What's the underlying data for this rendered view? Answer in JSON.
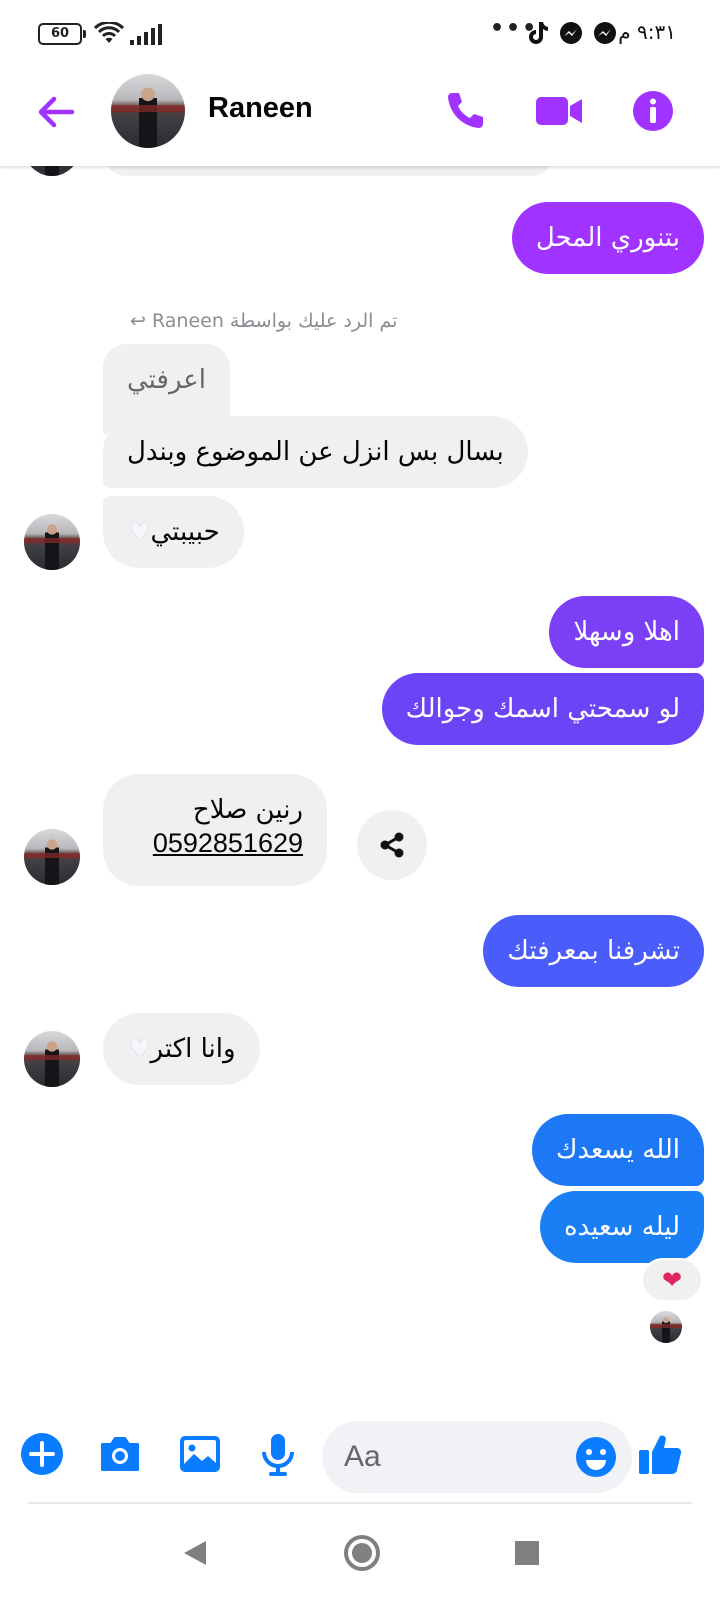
{
  "status_bar": {
    "battery": "60",
    "time": "٩:٣١ م",
    "dots": "•••",
    "icons": [
      "battery-icon",
      "wifi-icon",
      "signal-icon",
      "tiktok-icon",
      "messenger-icon",
      "messenger-icon"
    ]
  },
  "header": {
    "name": "Raneen",
    "accent": "#a033ff",
    "icons": [
      "back-arrow-icon",
      "phone-icon",
      "video-icon",
      "info-icon"
    ]
  },
  "messages": {
    "m1": "بتنوري المحل",
    "reply_label": "تم الرد عليك بواسطة Raneen ↩",
    "quoted": "اعرفتي",
    "m2": "بسال بس انزل عن الموضوع وبندل",
    "m3": "حبيبتي",
    "m4": "اهلا وسهلا",
    "m5": "لو سمحتي اسمك وجوالك",
    "contact_name": "رنين صلاح",
    "contact_phone": "0592851629",
    "m6": "تشرفنا بمعرفتك",
    "m7": "وانا اكتر",
    "m8": "الله يسعدك",
    "m9": "ليله سعيده",
    "reaction": "❤"
  },
  "bubble_colors": {
    "m1": "#a033ff",
    "m4": "#7b3ff6",
    "m5": "#6b44f5",
    "m6": "#4a5cf9",
    "m8": "#1e78f5",
    "m9": "#1a7ef5"
  },
  "composer": {
    "placeholder": "Aa",
    "icons": [
      "plus-icon",
      "camera-icon",
      "image-icon",
      "microphone-icon",
      "emoji-icon",
      "thumbs-up-icon"
    ]
  },
  "navbar": {
    "icons": [
      "back-triangle-icon",
      "home-circle-icon",
      "recents-square-icon"
    ]
  }
}
